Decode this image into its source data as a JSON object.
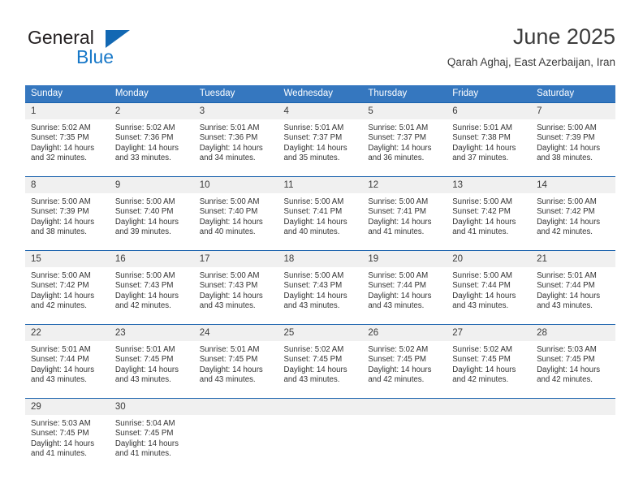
{
  "brand": {
    "name_part1": "General",
    "name_part2": "Blue",
    "colors": {
      "part1": "#231f20",
      "part2": "#1878c8",
      "triangle": "#1268b3"
    }
  },
  "header": {
    "title": "June 2025",
    "subtitle": "Qarah Aghaj, East Azerbaijan, Iran"
  },
  "theme": {
    "header_bar": "#3577bf",
    "week_separator": "#1a62ad",
    "day_number_band": "#f0f0f0",
    "text": "#333333"
  },
  "calendar": {
    "weekday_headers": [
      "Sunday",
      "Monday",
      "Tuesday",
      "Wednesday",
      "Thursday",
      "Friday",
      "Saturday"
    ],
    "weeks": [
      [
        {
          "day": "1",
          "sunrise": "Sunrise: 5:02 AM",
          "sunset": "Sunset: 7:35 PM",
          "daylight1": "Daylight: 14 hours",
          "daylight2": "and 32 minutes."
        },
        {
          "day": "2",
          "sunrise": "Sunrise: 5:02 AM",
          "sunset": "Sunset: 7:36 PM",
          "daylight1": "Daylight: 14 hours",
          "daylight2": "and 33 minutes."
        },
        {
          "day": "3",
          "sunrise": "Sunrise: 5:01 AM",
          "sunset": "Sunset: 7:36 PM",
          "daylight1": "Daylight: 14 hours",
          "daylight2": "and 34 minutes."
        },
        {
          "day": "4",
          "sunrise": "Sunrise: 5:01 AM",
          "sunset": "Sunset: 7:37 PM",
          "daylight1": "Daylight: 14 hours",
          "daylight2": "and 35 minutes."
        },
        {
          "day": "5",
          "sunrise": "Sunrise: 5:01 AM",
          "sunset": "Sunset: 7:37 PM",
          "daylight1": "Daylight: 14 hours",
          "daylight2": "and 36 minutes."
        },
        {
          "day": "6",
          "sunrise": "Sunrise: 5:01 AM",
          "sunset": "Sunset: 7:38 PM",
          "daylight1": "Daylight: 14 hours",
          "daylight2": "and 37 minutes."
        },
        {
          "day": "7",
          "sunrise": "Sunrise: 5:00 AM",
          "sunset": "Sunset: 7:39 PM",
          "daylight1": "Daylight: 14 hours",
          "daylight2": "and 38 minutes."
        }
      ],
      [
        {
          "day": "8",
          "sunrise": "Sunrise: 5:00 AM",
          "sunset": "Sunset: 7:39 PM",
          "daylight1": "Daylight: 14 hours",
          "daylight2": "and 38 minutes."
        },
        {
          "day": "9",
          "sunrise": "Sunrise: 5:00 AM",
          "sunset": "Sunset: 7:40 PM",
          "daylight1": "Daylight: 14 hours",
          "daylight2": "and 39 minutes."
        },
        {
          "day": "10",
          "sunrise": "Sunrise: 5:00 AM",
          "sunset": "Sunset: 7:40 PM",
          "daylight1": "Daylight: 14 hours",
          "daylight2": "and 40 minutes."
        },
        {
          "day": "11",
          "sunrise": "Sunrise: 5:00 AM",
          "sunset": "Sunset: 7:41 PM",
          "daylight1": "Daylight: 14 hours",
          "daylight2": "and 40 minutes."
        },
        {
          "day": "12",
          "sunrise": "Sunrise: 5:00 AM",
          "sunset": "Sunset: 7:41 PM",
          "daylight1": "Daylight: 14 hours",
          "daylight2": "and 41 minutes."
        },
        {
          "day": "13",
          "sunrise": "Sunrise: 5:00 AM",
          "sunset": "Sunset: 7:42 PM",
          "daylight1": "Daylight: 14 hours",
          "daylight2": "and 41 minutes."
        },
        {
          "day": "14",
          "sunrise": "Sunrise: 5:00 AM",
          "sunset": "Sunset: 7:42 PM",
          "daylight1": "Daylight: 14 hours",
          "daylight2": "and 42 minutes."
        }
      ],
      [
        {
          "day": "15",
          "sunrise": "Sunrise: 5:00 AM",
          "sunset": "Sunset: 7:42 PM",
          "daylight1": "Daylight: 14 hours",
          "daylight2": "and 42 minutes."
        },
        {
          "day": "16",
          "sunrise": "Sunrise: 5:00 AM",
          "sunset": "Sunset: 7:43 PM",
          "daylight1": "Daylight: 14 hours",
          "daylight2": "and 42 minutes."
        },
        {
          "day": "17",
          "sunrise": "Sunrise: 5:00 AM",
          "sunset": "Sunset: 7:43 PM",
          "daylight1": "Daylight: 14 hours",
          "daylight2": "and 43 minutes."
        },
        {
          "day": "18",
          "sunrise": "Sunrise: 5:00 AM",
          "sunset": "Sunset: 7:43 PM",
          "daylight1": "Daylight: 14 hours",
          "daylight2": "and 43 minutes."
        },
        {
          "day": "19",
          "sunrise": "Sunrise: 5:00 AM",
          "sunset": "Sunset: 7:44 PM",
          "daylight1": "Daylight: 14 hours",
          "daylight2": "and 43 minutes."
        },
        {
          "day": "20",
          "sunrise": "Sunrise: 5:00 AM",
          "sunset": "Sunset: 7:44 PM",
          "daylight1": "Daylight: 14 hours",
          "daylight2": "and 43 minutes."
        },
        {
          "day": "21",
          "sunrise": "Sunrise: 5:01 AM",
          "sunset": "Sunset: 7:44 PM",
          "daylight1": "Daylight: 14 hours",
          "daylight2": "and 43 minutes."
        }
      ],
      [
        {
          "day": "22",
          "sunrise": "Sunrise: 5:01 AM",
          "sunset": "Sunset: 7:44 PM",
          "daylight1": "Daylight: 14 hours",
          "daylight2": "and 43 minutes."
        },
        {
          "day": "23",
          "sunrise": "Sunrise: 5:01 AM",
          "sunset": "Sunset: 7:45 PM",
          "daylight1": "Daylight: 14 hours",
          "daylight2": "and 43 minutes."
        },
        {
          "day": "24",
          "sunrise": "Sunrise: 5:01 AM",
          "sunset": "Sunset: 7:45 PM",
          "daylight1": "Daylight: 14 hours",
          "daylight2": "and 43 minutes."
        },
        {
          "day": "25",
          "sunrise": "Sunrise: 5:02 AM",
          "sunset": "Sunset: 7:45 PM",
          "daylight1": "Daylight: 14 hours",
          "daylight2": "and 43 minutes."
        },
        {
          "day": "26",
          "sunrise": "Sunrise: 5:02 AM",
          "sunset": "Sunset: 7:45 PM",
          "daylight1": "Daylight: 14 hours",
          "daylight2": "and 42 minutes."
        },
        {
          "day": "27",
          "sunrise": "Sunrise: 5:02 AM",
          "sunset": "Sunset: 7:45 PM",
          "daylight1": "Daylight: 14 hours",
          "daylight2": "and 42 minutes."
        },
        {
          "day": "28",
          "sunrise": "Sunrise: 5:03 AM",
          "sunset": "Sunset: 7:45 PM",
          "daylight1": "Daylight: 14 hours",
          "daylight2": "and 42 minutes."
        }
      ],
      [
        {
          "day": "29",
          "sunrise": "Sunrise: 5:03 AM",
          "sunset": "Sunset: 7:45 PM",
          "daylight1": "Daylight: 14 hours",
          "daylight2": "and 41 minutes."
        },
        {
          "day": "30",
          "sunrise": "Sunrise: 5:04 AM",
          "sunset": "Sunset: 7:45 PM",
          "daylight1": "Daylight: 14 hours",
          "daylight2": "and 41 minutes."
        },
        {
          "day": "",
          "sunrise": "",
          "sunset": "",
          "daylight1": "",
          "daylight2": ""
        },
        {
          "day": "",
          "sunrise": "",
          "sunset": "",
          "daylight1": "",
          "daylight2": ""
        },
        {
          "day": "",
          "sunrise": "",
          "sunset": "",
          "daylight1": "",
          "daylight2": ""
        },
        {
          "day": "",
          "sunrise": "",
          "sunset": "",
          "daylight1": "",
          "daylight2": ""
        },
        {
          "day": "",
          "sunrise": "",
          "sunset": "",
          "daylight1": "",
          "daylight2": ""
        }
      ]
    ]
  }
}
